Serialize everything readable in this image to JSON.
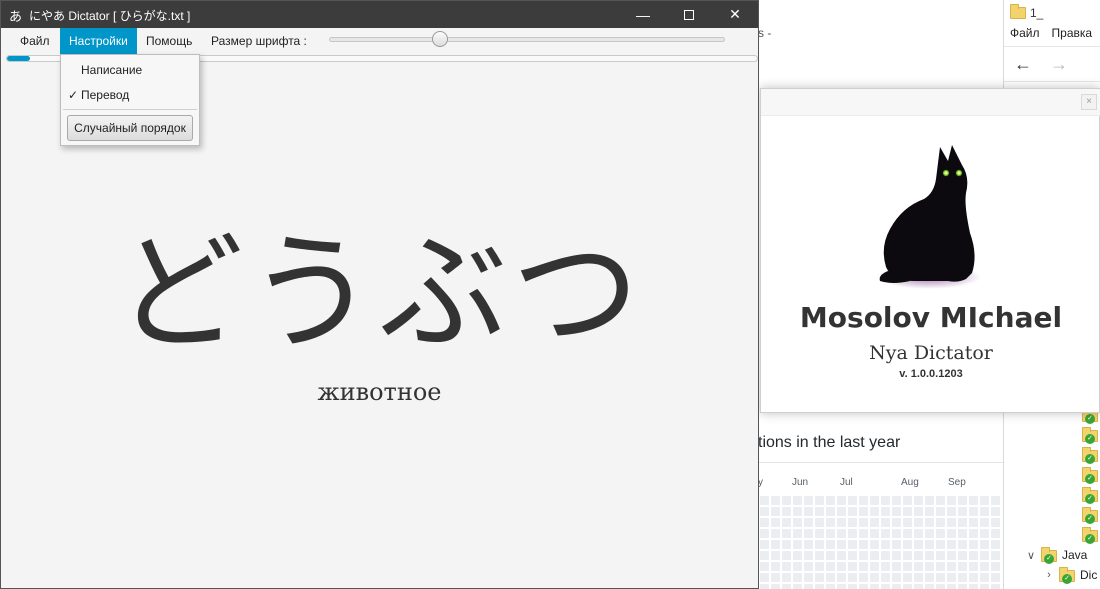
{
  "window": {
    "app_icon": "あ",
    "title": "にやあ  Dictator  [ ひらがな.txt ]",
    "minimize_glyph": "—",
    "close_glyph": "✕"
  },
  "menu": {
    "file": "Файл",
    "settings": "Настройки",
    "help": "Помощь",
    "font_size_label": "Размер шрифта :"
  },
  "font_size_slider": {
    "value_fraction": 0.27
  },
  "progress": {
    "value_fraction": 0.03
  },
  "dropdown": {
    "items": [
      {
        "label": "Написание",
        "checked": false
      },
      {
        "label": "Перевод",
        "checked": true
      }
    ],
    "checkmark": "✓",
    "random_order_button": "Случайный порядок"
  },
  "card": {
    "word": "どうぶつ",
    "translation": "животное"
  },
  "about": {
    "close_glyph": "×",
    "author": "Mosolov MIchael",
    "app_name": "Nya Dictator",
    "version": "v. 1.0.0.1203"
  },
  "background_page": {
    "fragment_top": "s -",
    "contributions_text": "tions in the last year",
    "months": [
      "y",
      "Jun",
      "Jul",
      "Aug",
      "Sep"
    ]
  },
  "explorer": {
    "title": "1_",
    "menu": [
      "Файл",
      "Правка"
    ],
    "back_arrow": "←",
    "forward_arrow": "→",
    "tree": [
      {
        "label": "Java",
        "chevron": "∨"
      },
      {
        "label": "Dic",
        "chevron": "›"
      }
    ]
  },
  "colors": {
    "accent": "#0096c9",
    "titlebar": "#3c3c3c",
    "window_bg": "#f4f4f4",
    "text": "#333333",
    "git_check": "#3aa535",
    "folder": "#f3d36b"
  }
}
